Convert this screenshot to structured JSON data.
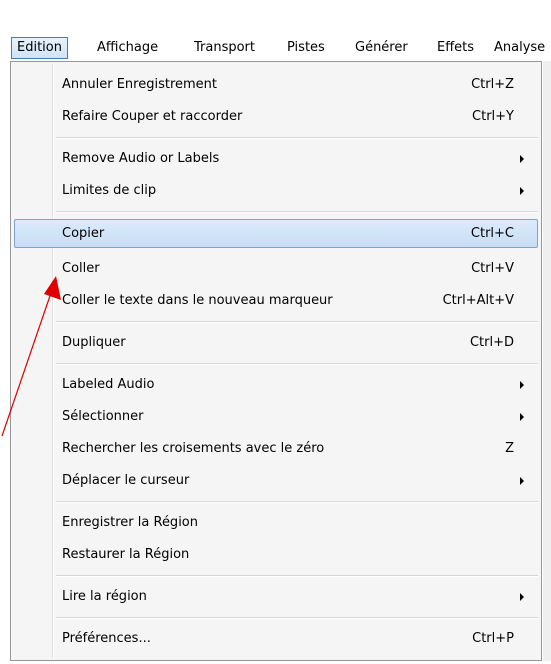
{
  "menubar": {
    "items": [
      {
        "label": "Edition",
        "active": true
      },
      {
        "label": "Affichage"
      },
      {
        "label": "Transport"
      },
      {
        "label": "Pistes"
      },
      {
        "label": "Générer"
      },
      {
        "label": "Effets"
      },
      {
        "label": "Analyse"
      }
    ]
  },
  "edit_menu": {
    "items": [
      {
        "label": "Annuler Enregistrement",
        "shortcut": "Ctrl+Z"
      },
      {
        "label": "Refaire Couper et raccorder",
        "shortcut": "Ctrl+Y"
      },
      {
        "label": "Remove Audio or Labels",
        "submenu": true
      },
      {
        "label": "Limites de clip",
        "submenu": true
      },
      {
        "label": "Copier",
        "shortcut": "Ctrl+C",
        "highlighted": true
      },
      {
        "label": "Coller",
        "shortcut": "Ctrl+V"
      },
      {
        "label": "Coller le texte dans le nouveau marqueur",
        "shortcut": "Ctrl+Alt+V"
      },
      {
        "label": "Dupliquer",
        "shortcut": "Ctrl+D"
      },
      {
        "label": "Labeled Audio",
        "submenu": true
      },
      {
        "label": "Sélectionner",
        "submenu": true
      },
      {
        "label": "Rechercher les croisements avec le zéro",
        "shortcut": "Z"
      },
      {
        "label": "Déplacer le curseur",
        "submenu": true
      },
      {
        "label": "Enregistrer la Région"
      },
      {
        "label": "Restaurer la Région"
      },
      {
        "label": "Lire la région",
        "submenu": true
      },
      {
        "label": "Préférences...",
        "shortcut": "Ctrl+P"
      }
    ]
  },
  "colors": {
    "highlight_border": "#7da2ce",
    "annotation_arrow": "#e00000"
  }
}
